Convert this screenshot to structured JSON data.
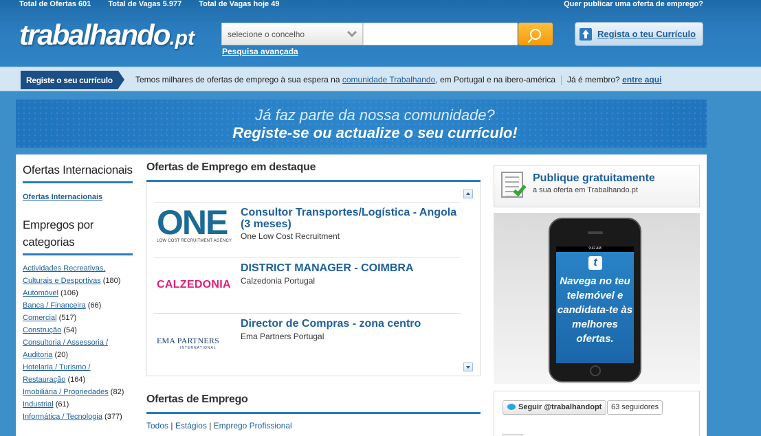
{
  "top_stats": {
    "total_ofertas": "Total de Ofertas 601",
    "total_vagas": "Total de Vagas 5.977",
    "total_vagas_hoje": "Total de Vagas hoje 49",
    "publish_question": "Quer publicar uma oferta de emprego?"
  },
  "header": {
    "logo_main": "trabalhando",
    "logo_suffix": ".pt",
    "location_placeholder": "selecione o concelho",
    "search_value": "",
    "advanced_search": "Pesquisa avançada",
    "cv_button": "Regista o teu Currículo"
  },
  "regbar": {
    "tag": "Registe o seu currículo",
    "text_before": "Temos milhares de ofertas de emprego à sua espera na ",
    "community_link": "comunidade Trabalhando",
    "text_after": ", em Portugal e na ibero-américa",
    "member_q": "Já é membro?",
    "enter_link": "entre aqui"
  },
  "banner": {
    "line1": "Já faz parte da nossa comunidade?",
    "line2": "Registe-se ou actualize o seu currículo!"
  },
  "left": {
    "intl_heading": "Ofertas Internacionais",
    "intl_link": "Ofertas Internacionais",
    "cat_heading": "Empregos por categorias",
    "categories": [
      {
        "name": "Actividades Recreativas, Culturais e Desportivas",
        "count": "(180)"
      },
      {
        "name": "Automóvel",
        "count": "(106)"
      },
      {
        "name": "Banca / Financeira",
        "count": "(66)"
      },
      {
        "name": "Comercial",
        "count": "(517)"
      },
      {
        "name": "Construção",
        "count": "(54)"
      },
      {
        "name": "Consultoria / Assessoria / Auditoria",
        "count": "(20)"
      },
      {
        "name": "Hotelaria / Turismo / Restauração",
        "count": "(164)"
      },
      {
        "name": "Imobiliária / Propriedades",
        "count": "(82)"
      },
      {
        "name": "Industrial",
        "count": "(61)"
      },
      {
        "name": "Informática / Tecnologia",
        "count": "(377)"
      }
    ]
  },
  "middle": {
    "featured_heading": "Ofertas de Emprego em destaque",
    "jobs": [
      {
        "logo_text": "ONE",
        "logo_sub": "LOW COST RECRUITMENT AGENCY",
        "title": "Consultor Transportes/Logística - Angola (3 meses)",
        "company": "One Low Cost Recruitment"
      },
      {
        "logo_text": "CALZEDONIA",
        "title": "DISTRICT MANAGER - COIMBRA",
        "company": "Calzedonia Portugal"
      },
      {
        "logo_text": "EMA PARTNERS",
        "logo_sub": "INTERNATIONAL",
        "title": "Director de Compras - zona centro",
        "company": "Ema Partners Portugal"
      }
    ],
    "offers_heading": "Ofertas de Emprego",
    "filter_links": [
      "Todos",
      "Estágios",
      "Emprego Profissional"
    ]
  },
  "right": {
    "publish_title": "Publique gratuitamente",
    "publish_sub": "a sua oferta em Trabalhando.pt",
    "phone_logo": "t",
    "phone_text": "Navega no teu telemóvel e candidata-te às melhores ofertas.",
    "phone_time": "9:42 AM",
    "twitter_follow": "Seguir @trabalhandopt",
    "twitter_followers": "63 seguidores"
  },
  "colors": {
    "header_blue": "#2a7bbd",
    "link_blue": "#1d5f9c",
    "accent_orange": "#f59b0a",
    "tag_navy": "#1c4f86",
    "calzedonia_pink": "#e21f7a"
  }
}
